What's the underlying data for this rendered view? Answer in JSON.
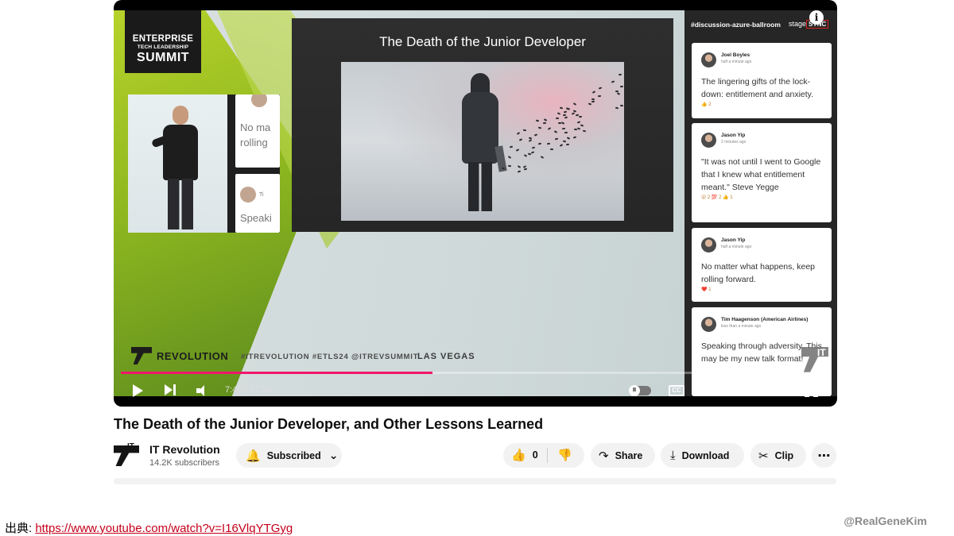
{
  "video": {
    "event_logo": {
      "line1": "ENTERPRISE",
      "line2": "TECH LEADERSHIP",
      "line3": "SUMMIT"
    },
    "slide_title": "The Death of the Junior Developer",
    "mini_chat": {
      "line1": "No ma",
      "line2": "rolling",
      "line3": "Speaki",
      "line4": "Ti"
    },
    "footer_brand": "REVOLUTION",
    "footer_brand_mark": "IT",
    "hashtags": "#ITREVOLUTION #ETLS24 @ITREVSUMMIT",
    "location": "LAS VEGAS",
    "chat_channel": "#discussion-azure-ballroom",
    "stagesync_prefix": "stage",
    "stagesync_suffix": "SYNC",
    "info_icon": "i",
    "chat": [
      {
        "name": "Joel Boyles",
        "time": "half a minute ago",
        "text": "The lingering gifts of the lock-down: entitlement and anxiety.",
        "reactions": "👍 2"
      },
      {
        "name": "Jason Yip",
        "time": "2 minutes ago",
        "text": "\"It was not until I went to Google that I knew what entitlement meant.\" Steve Yegge",
        "reactions": "😮 2   💯 2   👍 1"
      },
      {
        "name": "Jason Yip",
        "time": "half a minute ago",
        "text": "No matter what happens, keep rolling forward.",
        "reactions": "❤️ 1"
      },
      {
        "name": "Tim Haagenson (American Airlines)",
        "time": "less than a minute ago",
        "text": "Speaking through adversity. This may be my new talk format!",
        "reactions": ""
      }
    ],
    "watermark_text": "IT",
    "progress": 0.44,
    "time_display": "7:43 / 17:35",
    "cc_label": "CC",
    "settings_glyph": "⚙",
    "autoplay_glyph": "II"
  },
  "title": "The Death of the Junior Developer, and Other Lessons Learned",
  "channel": {
    "avatar_text": "IT",
    "name": "IT Revolution",
    "subscribers": "14.2K subscribers"
  },
  "actions": {
    "subscribed": "Subscribed",
    "subscribed_chevron": "⌄",
    "bell_glyph": "🔔",
    "likes": "0",
    "like_glyph": "👍",
    "dislike_glyph": "👎",
    "share": "Share",
    "share_glyph": "↷",
    "download": "Download",
    "download_glyph": "⤓",
    "clip": "Clip",
    "clip_glyph": "✂",
    "more": "⋯"
  },
  "source": {
    "label": "出典: ",
    "url": "https://www.youtube.com/watch?v=I16VlqYTGyg"
  },
  "handle": "@RealGeneKim",
  "colors": {
    "progress": "#f0166b",
    "link": "#c4001a",
    "accent_green": "#8fb81f"
  }
}
